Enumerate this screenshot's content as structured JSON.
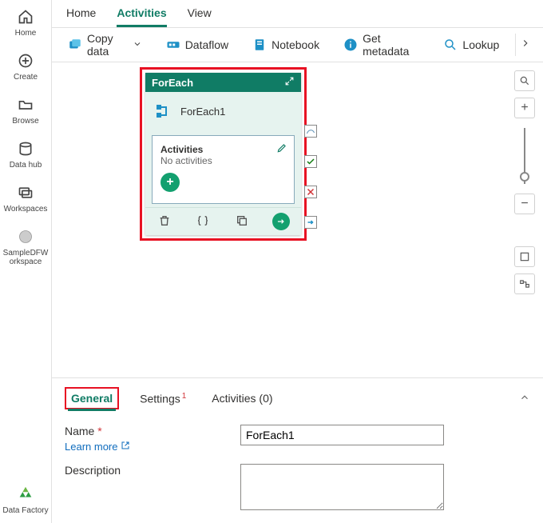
{
  "left_rail": {
    "home": "Home",
    "create": "Create",
    "browse": "Browse",
    "datahub": "Data hub",
    "workspaces": "Workspaces",
    "sample": "SampleDFWorkspace",
    "product": "Data Factory"
  },
  "top_tabs": {
    "home": "Home",
    "activities": "Activities",
    "view": "View"
  },
  "toolbar": {
    "copy_data": "Copy data",
    "dataflow": "Dataflow",
    "notebook": "Notebook",
    "get_metadata": "Get metadata",
    "lookup": "Lookup"
  },
  "foreach_card": {
    "title": "ForEach",
    "node_name": "ForEach1",
    "activities_label": "Activities",
    "no_activities": "No activities"
  },
  "props": {
    "tabs": {
      "general": "General",
      "settings": "Settings",
      "activities": "Activities (0)"
    },
    "name_label": "Name",
    "learn_more": "Learn more",
    "name_value": "ForEach1",
    "description_label": "Description",
    "description_value": ""
  }
}
